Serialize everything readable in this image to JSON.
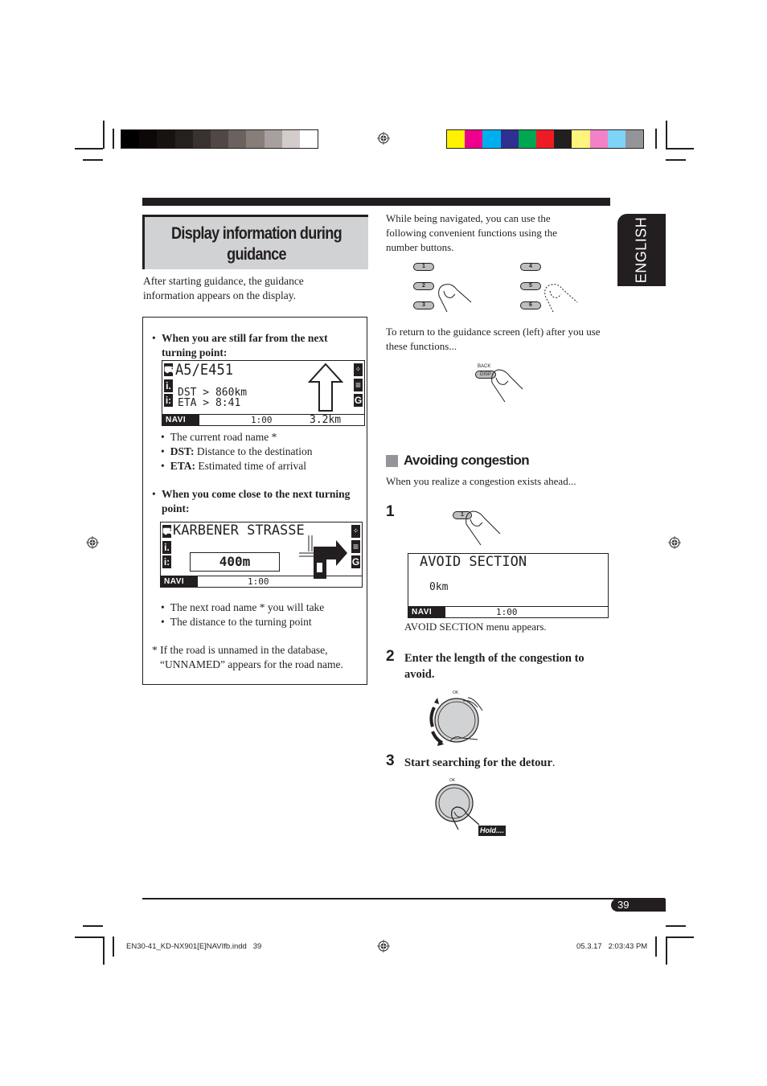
{
  "print_marks": {
    "gray_swatches": [
      "#000000",
      "#0b0807",
      "#181311",
      "#25201d",
      "#3a3230",
      "#514845",
      "#6b625f",
      "#877d79",
      "#a8a09e",
      "#d4cccb",
      "#ffffff"
    ],
    "color_swatches": [
      "#fff200",
      "#ec008c",
      "#00aeef",
      "#2e3192",
      "#00a651",
      "#ed1c24",
      "#231f20",
      "#fff57d",
      "#f282c5",
      "#7fd3f7",
      "#939598"
    ]
  },
  "section": {
    "title": "Display information during guidance",
    "intro": "After starting guidance, the guidance information appears on the display."
  },
  "info_box": {
    "far": {
      "heading": "When you are still far from the next turning point:",
      "display": {
        "road": "A5/E451",
        "dst": "DST > 860km",
        "eta": "ETA > 8:41",
        "mode": "NAVI",
        "time": "1:00",
        "distance": "3.2km"
      },
      "bullets": [
        {
          "bold": "",
          "text": "The current road name *"
        },
        {
          "bold": "DST:",
          "text": " Distance to the destination"
        },
        {
          "bold": "ETA:",
          "text": " Estimated time of arrival"
        }
      ]
    },
    "close": {
      "heading": "When you come close to the next turning point:",
      "display": {
        "road": "KARBENER STRASSE",
        "distance": "400m",
        "mode": "NAVI",
        "time": "1:00"
      },
      "bullets": [
        {
          "text": "The next road name * you will take"
        },
        {
          "text": "The distance to the turning point"
        }
      ]
    },
    "footnote": "* If the road is unnamed in the database, “UNNAMED” appears for the road name."
  },
  "right_column": {
    "intro": "While being navigated, you can use the following convenient functions using the number buttons.",
    "buttons_left": [
      "1",
      "2",
      "3"
    ],
    "buttons_right": [
      "4",
      "5",
      "6"
    ],
    "return_text": "To return to the guidance screen (left) after you use these functions...",
    "back_label": "BACK",
    "disp_label": "DISP"
  },
  "language_tab": "ENGLISH",
  "avoiding": {
    "heading": "Avoiding congestion",
    "intro": "When you realize a congestion exists ahead...",
    "steps": [
      {
        "num": "1",
        "button": "1"
      },
      {
        "num": "2",
        "text": "Enter the length of the congestion to avoid.",
        "knob_label": "OK"
      },
      {
        "num": "3",
        "text": "Start searching for the detour",
        "knob_label": "OK",
        "hold_label": "Hold...."
      }
    ],
    "display": {
      "title": "AVOID SECTION",
      "value": "0km",
      "mode": "NAVI",
      "time": "1:00"
    },
    "caption": "AVOID SECTION menu appears."
  },
  "footer": {
    "page_number": "39",
    "file": "EN30-41_KD-NX901[E]NAVIfb.indd   39",
    "date": "05.3.17   2:03:43 PM"
  }
}
